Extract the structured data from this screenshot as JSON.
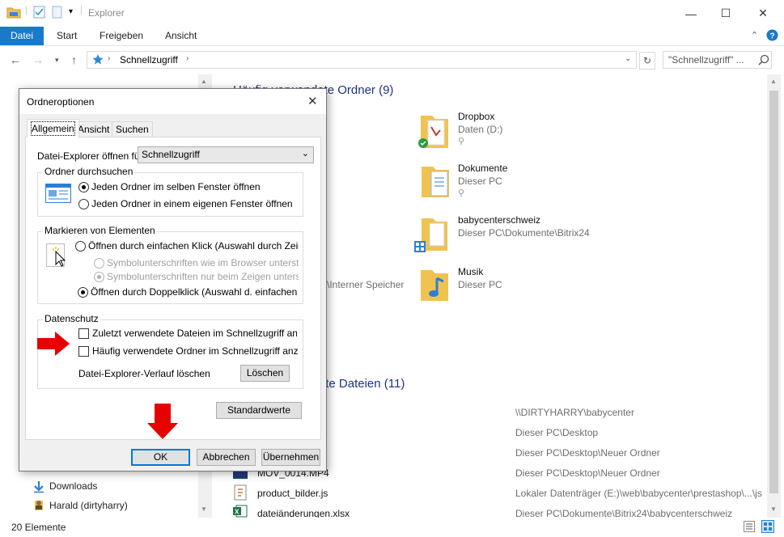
{
  "window": {
    "title": "Explorer",
    "minimize": "—",
    "maximize": "☐",
    "close": "✕"
  },
  "ribbon": {
    "tabs": [
      "Datei",
      "Start",
      "Freigeben",
      "Ansicht"
    ],
    "accent": "#1979ca"
  },
  "address": {
    "path": "Schnellzugriff",
    "search_placeholder": "\"Schnellzugriff\" ..."
  },
  "navpane": {
    "items": [
      "Downloads",
      "Harald (dirtyharry)"
    ]
  },
  "content": {
    "frequent_title": "Häufig verwendete Ordner (9)",
    "folders": [
      {
        "name": "Dropbox",
        "sub": "Daten (D:)"
      },
      {
        "name": "Dokumente",
        "sub": "Dieser PC"
      },
      {
        "name": "babycenterschweiz",
        "sub": "Dieser PC\\Dokumente\\Bitrix24"
      },
      {
        "name": "Musik",
        "sub": "Dieser PC"
      }
    ],
    "left_partial_sub": "\\Interner Speicher",
    "recent_title": "Zuletzt verwendete Dateien (11)",
    "recent_files": [
      {
        "name": "",
        "path": "\\\\DIRTYHARRY\\babycenter"
      },
      {
        "name": "",
        "path": "Dieser PC\\Desktop"
      },
      {
        "name": "",
        "path": "Dieser PC\\Desktop\\Neuer Ordner"
      },
      {
        "name": "MOV_0014.MP4",
        "path": "Dieser PC\\Desktop\\Neuer Ordner"
      },
      {
        "name": "product_bilder.js",
        "path": "Lokaler Datenträger (E:)\\web\\babycenter\\prestashop\\...\\js"
      },
      {
        "name": "dateiänderungen.xlsx",
        "path": "Dieser PC\\Dokumente\\Bitrix24\\babycenterschweiz"
      }
    ]
  },
  "statusbar": {
    "count": "20 Elemente"
  },
  "dialog": {
    "title": "Ordneroptionen",
    "tabs": [
      "Allgemein",
      "Ansicht",
      "Suchen"
    ],
    "open_label": "Datei-Explorer öffnen für:",
    "open_value": "Schnellzugriff",
    "group_browse": {
      "label": "Ordner durchsuchen",
      "opt1": "Jeden Ordner im selben Fenster öffnen",
      "opt2": "Jeden Ordner in einem eigenen Fenster öffnen"
    },
    "group_click": {
      "label": "Markieren von Elementen",
      "opt1": "Öffnen durch einfachen Klick (Auswahl durch Zeigen)",
      "sub1": "Symbolunterschriften wie im Browser unterstreichen",
      "sub2": "Symbolunterschriften nur beim Zeigen unterstreichen",
      "opt2": "Öffnen durch Doppelklick (Auswahl d. einfachen Klick)"
    },
    "group_privacy": {
      "label": "Datenschutz",
      "chk1": "Zuletzt verwendete Dateien im Schnellzugriff anzeigen",
      "chk2": "Häufig verwendete Ordner im Schnellzugriff anzeigen",
      "clear_label": "Datei-Explorer-Verlauf löschen",
      "clear_button": "Löschen"
    },
    "defaults_button": "Standardwerte",
    "ok": "OK",
    "cancel": "Abbrechen",
    "apply": "Übernehmen"
  },
  "colors": {
    "arrow": "#e60000",
    "group_title": "#1e3287",
    "accent": "#0078d7"
  }
}
